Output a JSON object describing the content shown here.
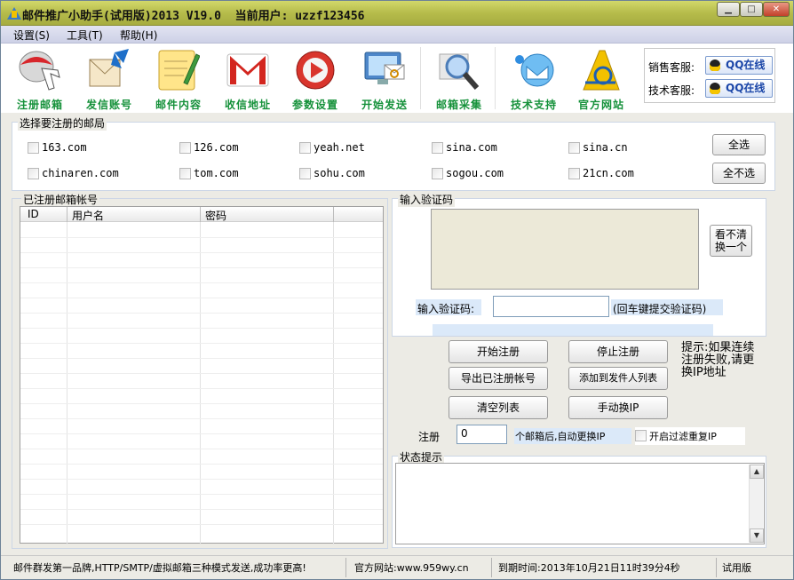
{
  "title": "邮件推广小助手(试用版)2013 V19.0  当前用户: uzzf123456",
  "menu": [
    "设置(S)",
    "工具(T)",
    "帮助(H)"
  ],
  "toolbar": [
    "注册邮箱",
    "发信账号",
    "邮件内容",
    "收信地址",
    "参数设置",
    "开始发送",
    "邮箱采集",
    "技术支持",
    "官方网站"
  ],
  "service": {
    "sales_label": "销售客服:",
    "tech_label": "技术客服:",
    "qq_button": "QQ在线"
  },
  "mailbox_select": {
    "title": "选择要注册的邮局",
    "row1": [
      "163.com",
      "126.com",
      "yeah.net",
      "sina.com",
      "sina.cn"
    ],
    "row2": [
      "chinaren.com",
      "tom.com",
      "sohu.com",
      "sogou.com",
      "21cn.com"
    ],
    "select_all": "全选",
    "deselect_all": "全不选"
  },
  "registered": {
    "title": "已注册邮箱帐号",
    "columns": [
      "ID",
      "用户名",
      "密码"
    ]
  },
  "captcha": {
    "title": "输入验证码",
    "refresh": "看不清换一个",
    "input_label": "输入验证码:",
    "input_value": "",
    "hint": "(回车键提交验证码)"
  },
  "actions": {
    "start": "开始注册",
    "stop": "停止注册",
    "export": "导出已注册帐号",
    "add_sender": "添加到发件人列表",
    "clear": "清空列表",
    "change_ip": "手动换IP",
    "tip": "提示:如果连续注册失败,请更换IP地址",
    "reg_label": "注册",
    "reg_count": "0",
    "after_label": "个邮箱后,自动更换IP",
    "filter_ip": "开启过滤重复IP"
  },
  "status": {
    "title": "状态提示",
    "content": ""
  },
  "statusbar": {
    "slogan": "邮件群发第一品牌,HTTP/SMTP/虚拟邮箱三种模式发送,成功率更高!",
    "site": "官方网站:www.959wy.cn",
    "expire": "到期时间:2013年10月21日11时39分4秒",
    "edition": "试用版"
  },
  "colors": {
    "title_bar": "#c7cd5c",
    "toolbar_label": "#15913a",
    "menu_bar": "#d7dbee",
    "panel_bg": "#ecebe5"
  }
}
